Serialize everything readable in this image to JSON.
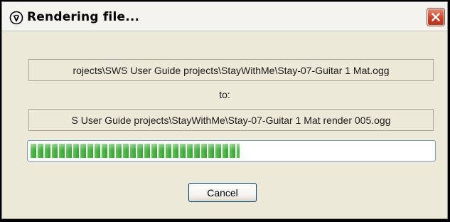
{
  "window": {
    "title": "Rendering file...",
    "icon": "reaper-icon",
    "close_icon": "close-icon"
  },
  "render": {
    "source_path": "rojects\\SWS User Guide projects\\StayWithMe\\Stay-07-Guitar 1 Mat.ogg",
    "to_label": "to:",
    "destination_path": "S User Guide projects\\StayWithMe\\Stay-07-Guitar 1 Mat render 005.ogg",
    "progress_fraction": 0.52
  },
  "buttons": {
    "cancel_label": "Cancel"
  },
  "colors": {
    "progress_green": "#3aa235",
    "close_red": "#c9422b",
    "dialog_bg": "#ece9d8"
  }
}
